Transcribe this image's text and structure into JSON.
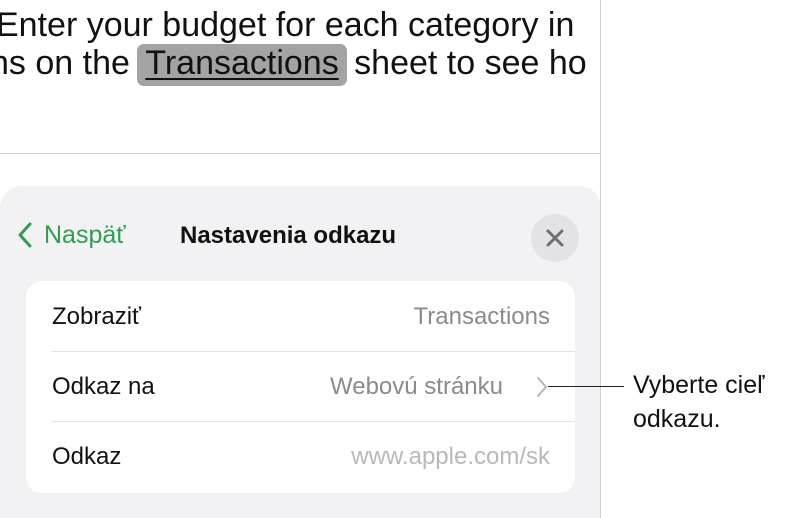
{
  "document": {
    "line1": "Enter your budget for each category in",
    "line2_before": "ns on the",
    "line2_link": "Transactions",
    "line2_after": "sheet to see ho"
  },
  "sheet": {
    "back_label": "Naspäť",
    "title": "Nastavenia odkazu",
    "rows": [
      {
        "label": "Zobraziť",
        "value": "Transactions"
      },
      {
        "label": "Odkaz na",
        "value": "Webovú stránku"
      },
      {
        "label": "Odkaz",
        "value": "www.apple.com/sk"
      }
    ]
  },
  "callout": {
    "line1": "Vyberte cieľ",
    "line2": "odkazu."
  },
  "colors": {
    "accent": "#2f9e4f",
    "sheet_background": "#f2f2f4",
    "link_highlight": "#a3a3a3"
  },
  "icons": {
    "back": "chevron-left-icon",
    "close": "close-icon",
    "disclosure": "chevron-right-icon"
  }
}
